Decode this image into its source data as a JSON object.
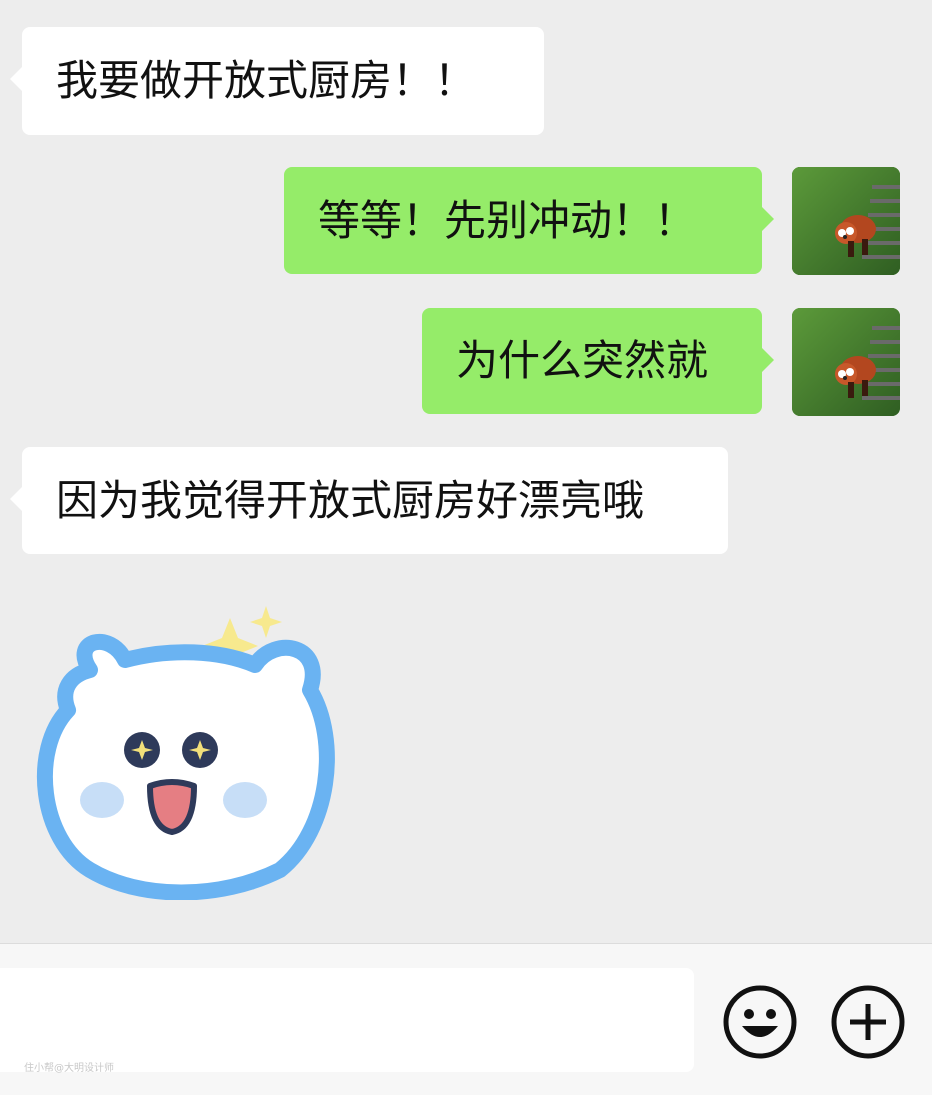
{
  "messages": [
    {
      "side": "incoming",
      "text": "我要做开放式厨房！！"
    },
    {
      "side": "outgoing",
      "text": "等等！先别冲动！！"
    },
    {
      "side": "outgoing",
      "text": "为什么突然就"
    },
    {
      "side": "incoming",
      "text": "因为我觉得开放式厨房好漂亮哦"
    }
  ],
  "sticker": {
    "name": "smiling-white-bear-sticker",
    "outline_color": "#6ab3f2",
    "sparkle_color": "#f7e98e"
  },
  "avatar": {
    "name": "red-panda-avatar"
  },
  "input_bar": {
    "value": "",
    "emoji_icon": "emoji-smile-icon",
    "plus_icon": "plus-circle-icon"
  },
  "watermark": "住小帮@大明设计师",
  "colors": {
    "background": "#ededed",
    "outgoing_bubble": "#95ec69",
    "incoming_bubble": "#ffffff"
  }
}
